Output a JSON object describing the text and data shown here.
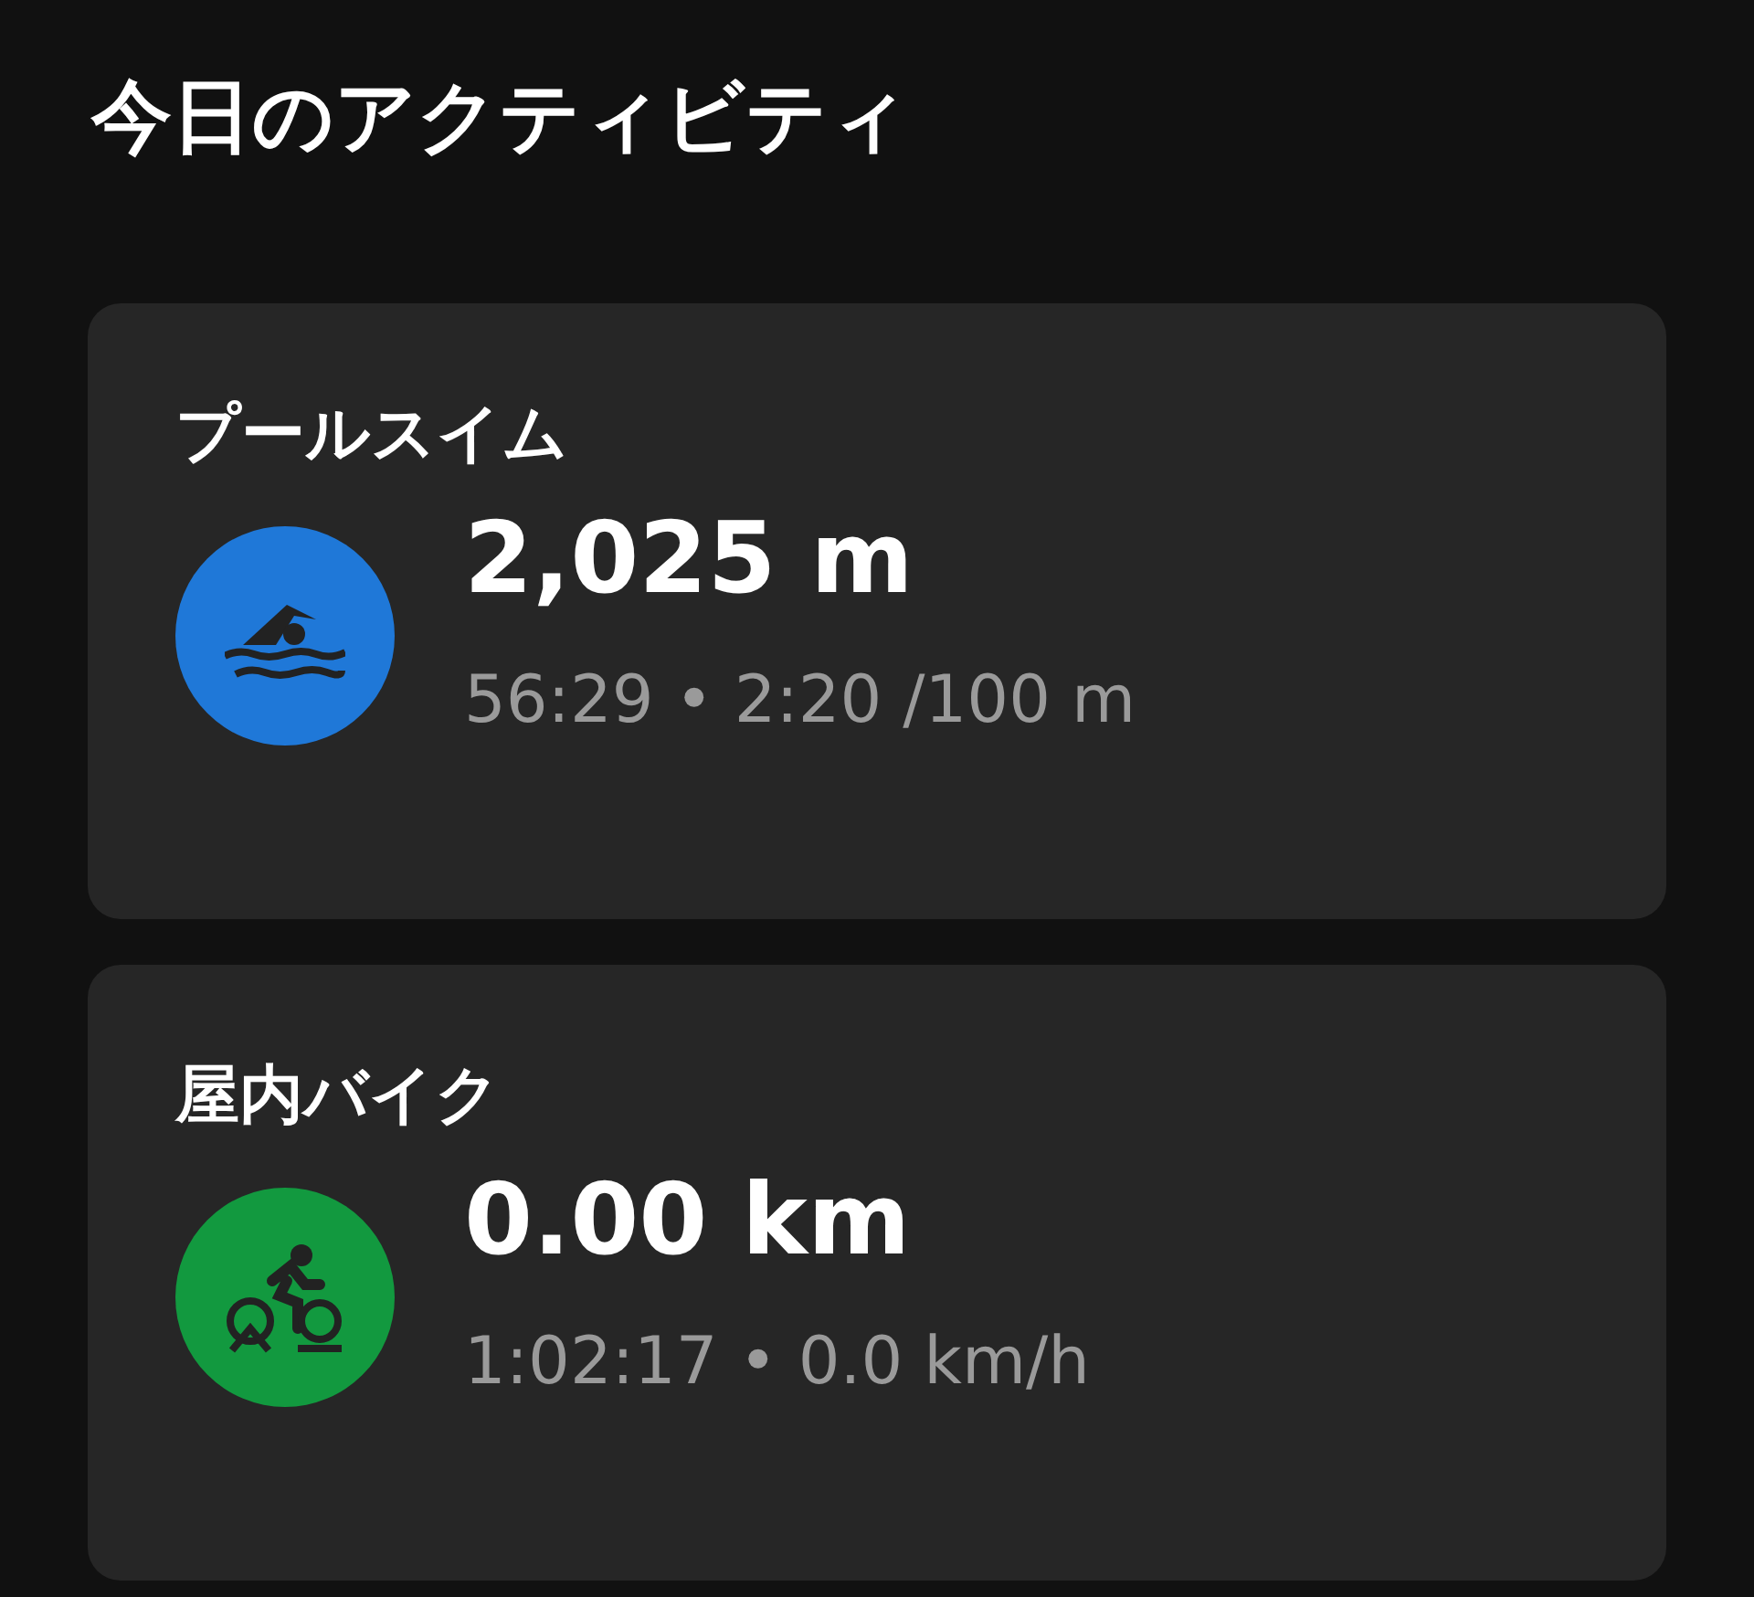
{
  "title": "今日のアクティビティ",
  "activities": [
    {
      "name": "プールスイム",
      "kind": "swim",
      "color": "#1f78d8",
      "value": "2,025 m",
      "details": "56:29 • 2:20 /100 m"
    },
    {
      "name": "屋内バイク",
      "kind": "bike",
      "color": "#12993f",
      "value": "0.00 km",
      "details": "1:02:17 • 0.0 km/h"
    }
  ]
}
